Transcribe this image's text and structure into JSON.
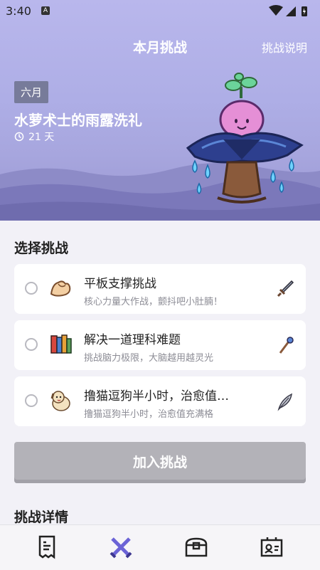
{
  "status": {
    "time": "3:40",
    "a_icon": "A"
  },
  "header": {
    "title": "本月挑战",
    "link": "挑战说明"
  },
  "hero": {
    "month": "六月",
    "title": "水萝术士的雨露洗礼",
    "duration": "21 天"
  },
  "section_title": "选择挑战",
  "challenges": [
    {
      "title": "平板支撑挑战",
      "subtitle": "核心力量大作战，颤抖吧小肚腩！",
      "emoji_icon": "flexed-biceps-icon",
      "tool_icon": "sword-icon"
    },
    {
      "title": "解决一道理科难题",
      "subtitle": "挑战脑力极限，大脑越用越灵光",
      "emoji_icon": "books-icon",
      "tool_icon": "magic-staff-icon"
    },
    {
      "title": "撸猫逗狗半小时，治愈值…",
      "subtitle": "撸猫逗狗半小时，治愈值充满格",
      "emoji_icon": "dog-icon",
      "tool_icon": "feather-icon"
    }
  ],
  "join_button": "加入挑战",
  "detail_title": "挑战详情",
  "nav": [
    "receipt-icon",
    "crossed-swords-icon",
    "treasure-chest-icon",
    "profile-card-icon"
  ],
  "colors": {
    "accent": "#6b63d6",
    "header_bg": "#b1aee8",
    "button_disabled": "#b3b2b8"
  }
}
